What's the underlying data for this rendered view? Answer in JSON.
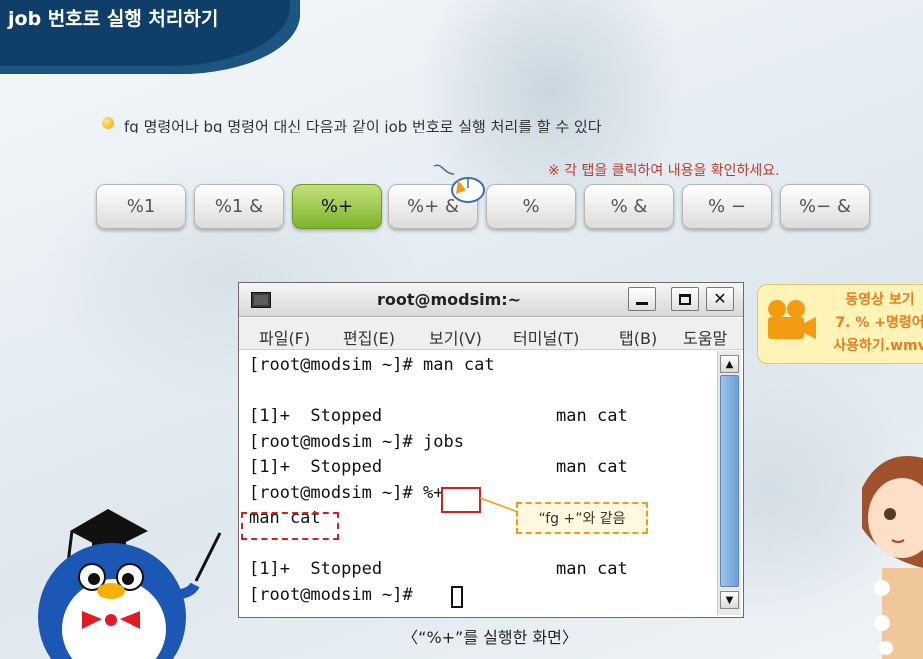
{
  "page": {
    "title": "job 번호로 실행 처리하기",
    "bullet": "fg 명령어나 bg 명령어 대신 다음과 같이 job 번호로 실행 처리를 할 수 있다",
    "hint": "※ 각 탭을 클릭하여 내용을 확인하세요.",
    "caption": "〈“%+”를 실행한 화면〉"
  },
  "tabs": [
    {
      "label": "%1"
    },
    {
      "label": "%1 &"
    },
    {
      "label": "%+"
    },
    {
      "label": "%+ &"
    },
    {
      "label": "%"
    },
    {
      "label": "% &"
    },
    {
      "label": "% −"
    },
    {
      "label": "%− &"
    }
  ],
  "active_tab_index": 2,
  "terminal": {
    "title": "root@modsim:~",
    "menu": [
      "파일(F)",
      "편집(E)",
      "보기(V)",
      "터미널(T)",
      "탭(B)",
      "도움말"
    ],
    "lines": [
      "[root@modsim ~]# man cat",
      "",
      "[1]+  Stopped                 man cat",
      "[root@modsim ~]# jobs",
      "[1]+  Stopped                 man cat",
      "[root@modsim ~]# %+",
      "man cat",
      "",
      "[1]+  Stopped                 man cat",
      "[root@modsim ~]# "
    ]
  },
  "callout": {
    "text": "“fg +”와 같음"
  },
  "video": {
    "line1": "동영상 보기",
    "line2": "7. % +명령어",
    "line3": "사용하기.wmv"
  },
  "colors": {
    "banner": "#0f3f68",
    "active_tab": "#7fb42b",
    "highlight": "#d91e1e",
    "callout_border": "#f39c12"
  }
}
